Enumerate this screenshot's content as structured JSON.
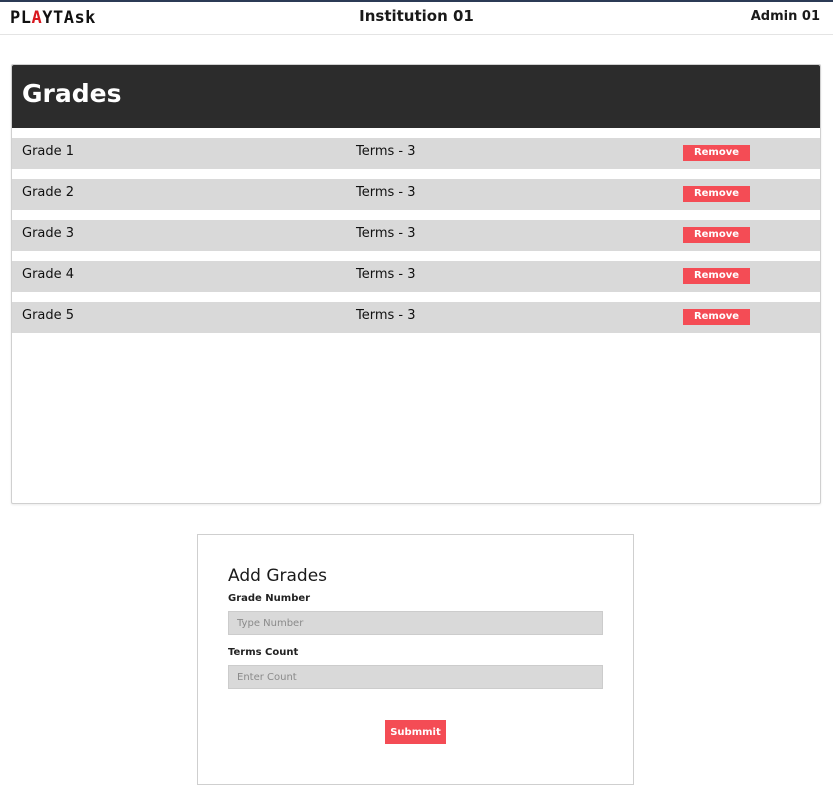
{
  "header": {
    "logo_p1": "PL",
    "logo_accent": "A",
    "logo_p2": "YTAsk",
    "title": "Institution 01",
    "user": "Admin 01"
  },
  "grades_panel": {
    "title": "Grades",
    "remove_label": "Remove",
    "rows": [
      {
        "name": "Grade 1",
        "terms": "Terms - 3"
      },
      {
        "name": "Grade 2",
        "terms": "Terms - 3"
      },
      {
        "name": "Grade 3",
        "terms": "Terms - 3"
      },
      {
        "name": "Grade 4",
        "terms": "Terms - 3"
      },
      {
        "name": "Grade 5",
        "terms": "Terms - 3"
      }
    ]
  },
  "add_form": {
    "title": "Add Grades",
    "grade_number_label": "Grade Number",
    "grade_number_placeholder": "Type Number",
    "grade_number_value": "",
    "terms_count_label": "Terms Count",
    "terms_count_placeholder": "Enter Count",
    "terms_count_value": "",
    "submit_label": "Submmit"
  },
  "colors": {
    "header_bg": "#2c2c2c",
    "row_bg": "#d9d9d9",
    "accent_red": "#f44c55",
    "logo_red": "#d9181f"
  }
}
